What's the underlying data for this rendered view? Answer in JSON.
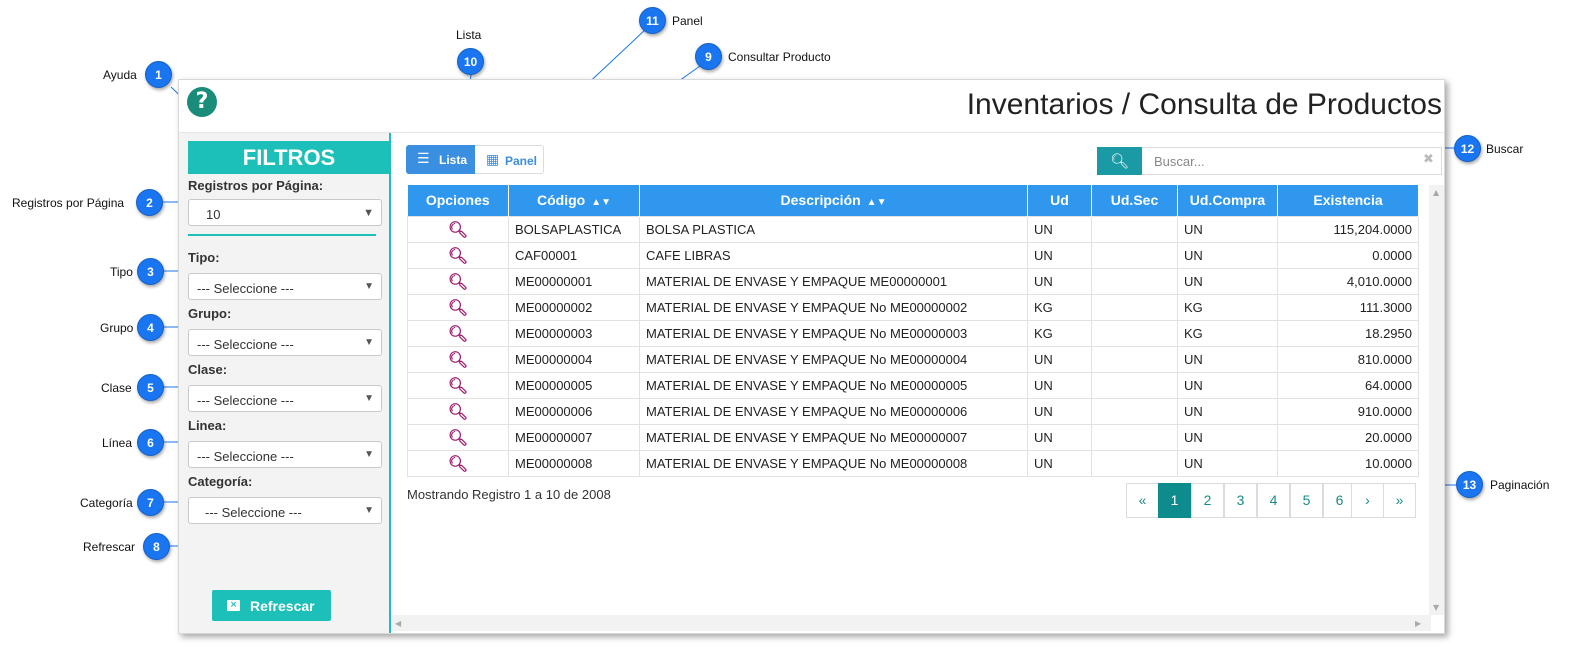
{
  "window": {
    "title": "Inventarios / Consulta de Productos",
    "help_icon": "question-circle-icon"
  },
  "sidebar": {
    "header": "FILTROS",
    "registros_label": "Registros por Página:",
    "registros_value": "10",
    "filters": [
      {
        "label": "Tipo:",
        "value": "--- Seleccione ---"
      },
      {
        "label": "Grupo:",
        "value": "--- Seleccione ---"
      },
      {
        "label": "Clase:",
        "value": "--- Seleccione ---"
      },
      {
        "label": "Linea:",
        "value": "--- Seleccione ---"
      },
      {
        "label": "Categoría:",
        "value": "--- Seleccione ---"
      }
    ],
    "refresh_label": "Refrescar"
  },
  "toolbar": {
    "lista_label": "Lista",
    "panel_label": "Panel",
    "search_placeholder": "Buscar...",
    "clear_glyph": "✖"
  },
  "table": {
    "columns": [
      "Opciones",
      "Código",
      "Descripción",
      "Ud",
      "Ud.Sec",
      "Ud.Compra",
      "Existencia"
    ],
    "rows": [
      {
        "codigo": "BOLSAPLASTICA",
        "descripcion": "BOLSA PLASTICA",
        "ud": "UN",
        "udsec": "",
        "udcompra": "UN",
        "existencia": "115,204.0000"
      },
      {
        "codigo": "CAF00001",
        "descripcion": "CAFE LIBRAS",
        "ud": "UN",
        "udsec": "",
        "udcompra": "UN",
        "existencia": "0.0000"
      },
      {
        "codigo": "ME00000001",
        "descripcion": "MATERIAL DE ENVASE Y EMPAQUE ME00000001",
        "ud": "UN",
        "udsec": "",
        "udcompra": "UN",
        "existencia": "4,010.0000"
      },
      {
        "codigo": "ME00000002",
        "descripcion": "MATERIAL DE ENVASE Y EMPAQUE No ME00000002",
        "ud": "KG",
        "udsec": "",
        "udcompra": "KG",
        "existencia": "111.3000"
      },
      {
        "codigo": "ME00000003",
        "descripcion": "MATERIAL DE ENVASE Y EMPAQUE No ME00000003",
        "ud": "KG",
        "udsec": "",
        "udcompra": "KG",
        "existencia": "18.2950"
      },
      {
        "codigo": "ME00000004",
        "descripcion": "MATERIAL DE ENVASE Y EMPAQUE No ME00000004",
        "ud": "UN",
        "udsec": "",
        "udcompra": "UN",
        "existencia": "810.0000"
      },
      {
        "codigo": "ME00000005",
        "descripcion": "MATERIAL DE ENVASE Y EMPAQUE No ME00000005",
        "ud": "UN",
        "udsec": "",
        "udcompra": "UN",
        "existencia": "64.0000"
      },
      {
        "codigo": "ME00000006",
        "descripcion": "MATERIAL DE ENVASE Y EMPAQUE No ME00000006",
        "ud": "UN",
        "udsec": "",
        "udcompra": "UN",
        "existencia": "910.0000"
      },
      {
        "codigo": "ME00000007",
        "descripcion": "MATERIAL DE ENVASE Y EMPAQUE No ME00000007",
        "ud": "UN",
        "udsec": "",
        "udcompra": "UN",
        "existencia": "20.0000"
      },
      {
        "codigo": "ME00000008",
        "descripcion": "MATERIAL DE ENVASE Y EMPAQUE No ME00000008",
        "ud": "UN",
        "udsec": "",
        "udcompra": "UN",
        "existencia": "10.0000"
      }
    ]
  },
  "status_text": "Mostrando Registro 1 a 10 de 2008",
  "pagination": {
    "items": [
      "«",
      "1",
      "2",
      "3",
      "4",
      "5",
      "6",
      "›",
      "»"
    ],
    "active": "1"
  },
  "callouts": [
    {
      "num": "1",
      "label": "Ayuda"
    },
    {
      "num": "2",
      "label": "Registros por Página"
    },
    {
      "num": "3",
      "label": "Tipo"
    },
    {
      "num": "4",
      "label": "Grupo"
    },
    {
      "num": "5",
      "label": "Clase"
    },
    {
      "num": "6",
      "label": "Línea"
    },
    {
      "num": "7",
      "label": "Categoría"
    },
    {
      "num": "8",
      "label": "Refrescar"
    },
    {
      "num": "9",
      "label": "Consultar Producto"
    },
    {
      "num": "10",
      "label": "Lista"
    },
    {
      "num": "11",
      "label": "Panel"
    },
    {
      "num": "12",
      "label": "Buscar"
    },
    {
      "num": "13",
      "label": "Paginación"
    }
  ],
  "colors": {
    "teal": "#1cc0b8",
    "blue_header": "#2f97ee",
    "callout_blue": "#1976f0",
    "search_teal": "#1a9aa5",
    "view_icon_magenta": "#a01f6e"
  }
}
